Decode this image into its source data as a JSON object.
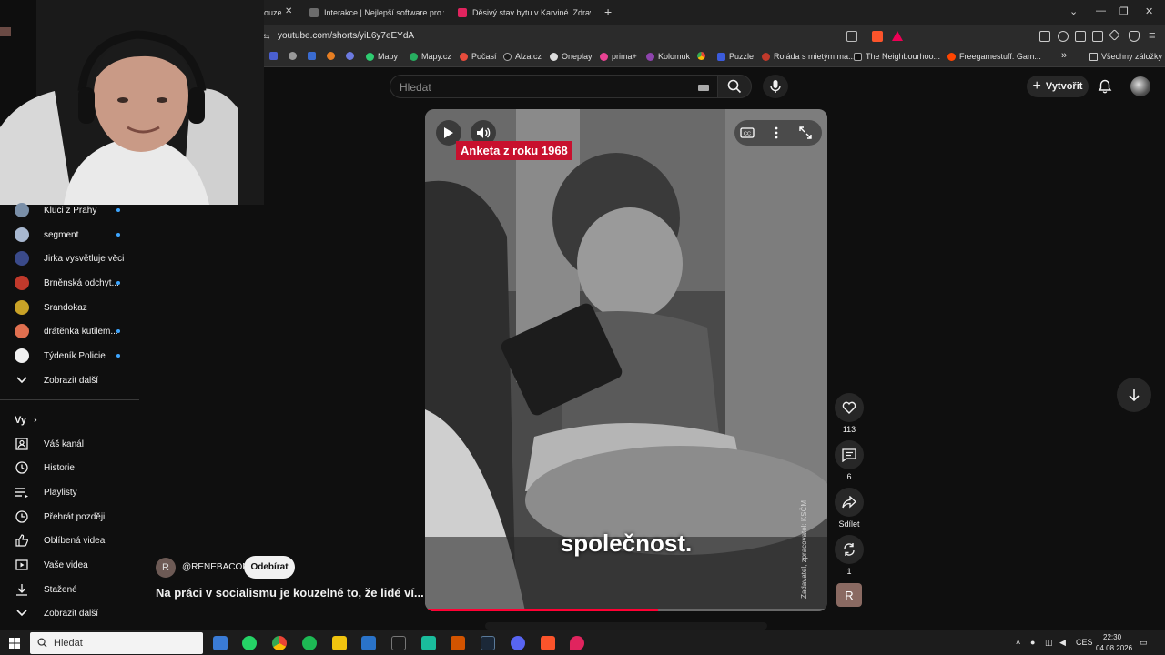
{
  "browser": {
    "tabs": [
      {
        "title": "ouze",
        "active": true
      },
      {
        "title": "Interakce | Nejlepší software pro vyle",
        "active": false
      },
      {
        "title": "Děsivý stav bytu v Karviné. Zdraví ná",
        "active": false
      }
    ],
    "new_tab_label": "+",
    "url": "youtube.com/shorts/yiL6y7eEYdA",
    "bookmarks": [
      "Mapy",
      "Mapy.cz",
      "Počasí",
      "Alza.cz",
      "Oneplay",
      "prima+",
      "Kolomuk",
      "Puzzle",
      "Roláda s mietým ma...",
      "The Neighbourhoo...",
      "Freegamestuff: Gam..."
    ],
    "all_bookmarks": "Všechny záložky",
    "overflow": "»"
  },
  "header": {
    "search_placeholder": "Hledat",
    "create_label": "Vytvořit"
  },
  "sidebar": {
    "subscriptions": [
      {
        "label": "Kluci z Prahy",
        "new": true,
        "color": "#7a8fa8"
      },
      {
        "label": "segment",
        "new": true,
        "color": "#a8b8d0"
      },
      {
        "label": "Jirka vysvětluje věci",
        "new": false,
        "color": "#3a4a8a"
      },
      {
        "label": "Brněnská odchyt...",
        "new": true,
        "color": "#c0392b"
      },
      {
        "label": "Srandokaz",
        "new": false,
        "color": "#c9a227"
      },
      {
        "label": "drátěnka kutilem...",
        "new": true,
        "color": "#e07050"
      },
      {
        "label": "Týdeník Policie",
        "new": true,
        "color": "#f1f1f1"
      }
    ],
    "show_more_1": "Zobrazit další",
    "you_heading": "Vy",
    "you_items": [
      {
        "label": "Váš kanál",
        "icon": "channel-icon"
      },
      {
        "label": "Historie",
        "icon": "history-icon"
      },
      {
        "label": "Playlisty",
        "icon": "playlists-icon"
      },
      {
        "label": "Přehrát později",
        "icon": "watch-later-icon"
      },
      {
        "label": "Oblíbená videa",
        "icon": "liked-icon"
      },
      {
        "label": "Vaše videa",
        "icon": "your-videos-icon"
      },
      {
        "label": "Stažené",
        "icon": "downloads-icon"
      }
    ],
    "show_more_2": "Zobrazit další"
  },
  "short": {
    "overlay_label": "Anketa z roku 1968",
    "caption": "společnost.",
    "watermark": "Zadavatel, zpracovatel: KSČM",
    "progress": 0.58,
    "likes": "113",
    "comments": "6",
    "share_label": "Sdílet",
    "remix_count": "1",
    "channel_initial": "R",
    "channel_handle": "@RENEBACON",
    "subscribe_label": "Odebírat",
    "title": "Na práci v socialismu je kouzelné to, že lidé ví..."
  },
  "taskbar": {
    "search_placeholder": "Hledat",
    "language": "CES",
    "time": "22:30",
    "date": "04.08.2026"
  },
  "colors": {
    "accent": "#ff0033",
    "new_dot": "#3ea6ff",
    "overlay_red": "#c8102e"
  }
}
